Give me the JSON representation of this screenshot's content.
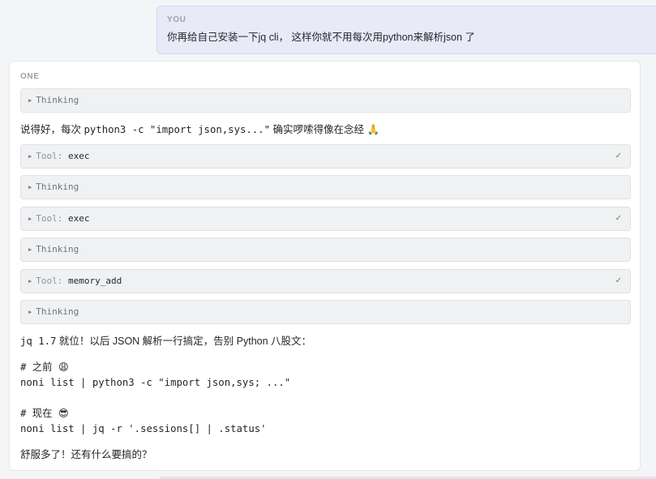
{
  "user_message": {
    "role": "YOU",
    "text": "你再给自己安装一下jq cli， 这样你就不用每次用python来解析json 了"
  },
  "assistant": {
    "role": "ONE",
    "intro": {
      "prefix": "说得好，每次 ",
      "code": "python3 -c \"import json,sys...\"",
      "suffix": " 确实啰嗦得像在念经 ",
      "emoji": "🙏"
    },
    "steps": [
      {
        "kind": "thinking",
        "label": "Thinking"
      },
      {
        "kind": "tool",
        "prefix": "Tool:",
        "name": "exec",
        "status_icon": "✓"
      },
      {
        "kind": "thinking",
        "label": "Thinking"
      },
      {
        "kind": "tool",
        "prefix": "Tool:",
        "name": "exec",
        "status_icon": "✓"
      },
      {
        "kind": "thinking",
        "label": "Thinking"
      },
      {
        "kind": "tool",
        "prefix": "Tool:",
        "name": "memory_add",
        "status_icon": "✓"
      },
      {
        "kind": "thinking",
        "label": "Thinking"
      }
    ],
    "ready_line": {
      "code": "jq 1.7",
      "text": " 就位！以后 JSON 解析一行搞定，告别 Python 八股文："
    },
    "code_block": {
      "before_comment": "# 之前 ",
      "before_emoji": "😩",
      "before_cmd": "noni list | python3 -c \"import json,sys; ...\"",
      "after_comment": "# 现在 ",
      "after_emoji": "😎",
      "after_cmd": "noni list | jq -r '.sessions[] | .status'"
    },
    "closing": "舒服多了！还有什么要搞的？"
  },
  "colors": {
    "user_bubble": "#e9e9f7",
    "card_bg": "#ffffff",
    "collapsible_bg": "#f0f1f3",
    "check_green": "#3a9a5a"
  }
}
